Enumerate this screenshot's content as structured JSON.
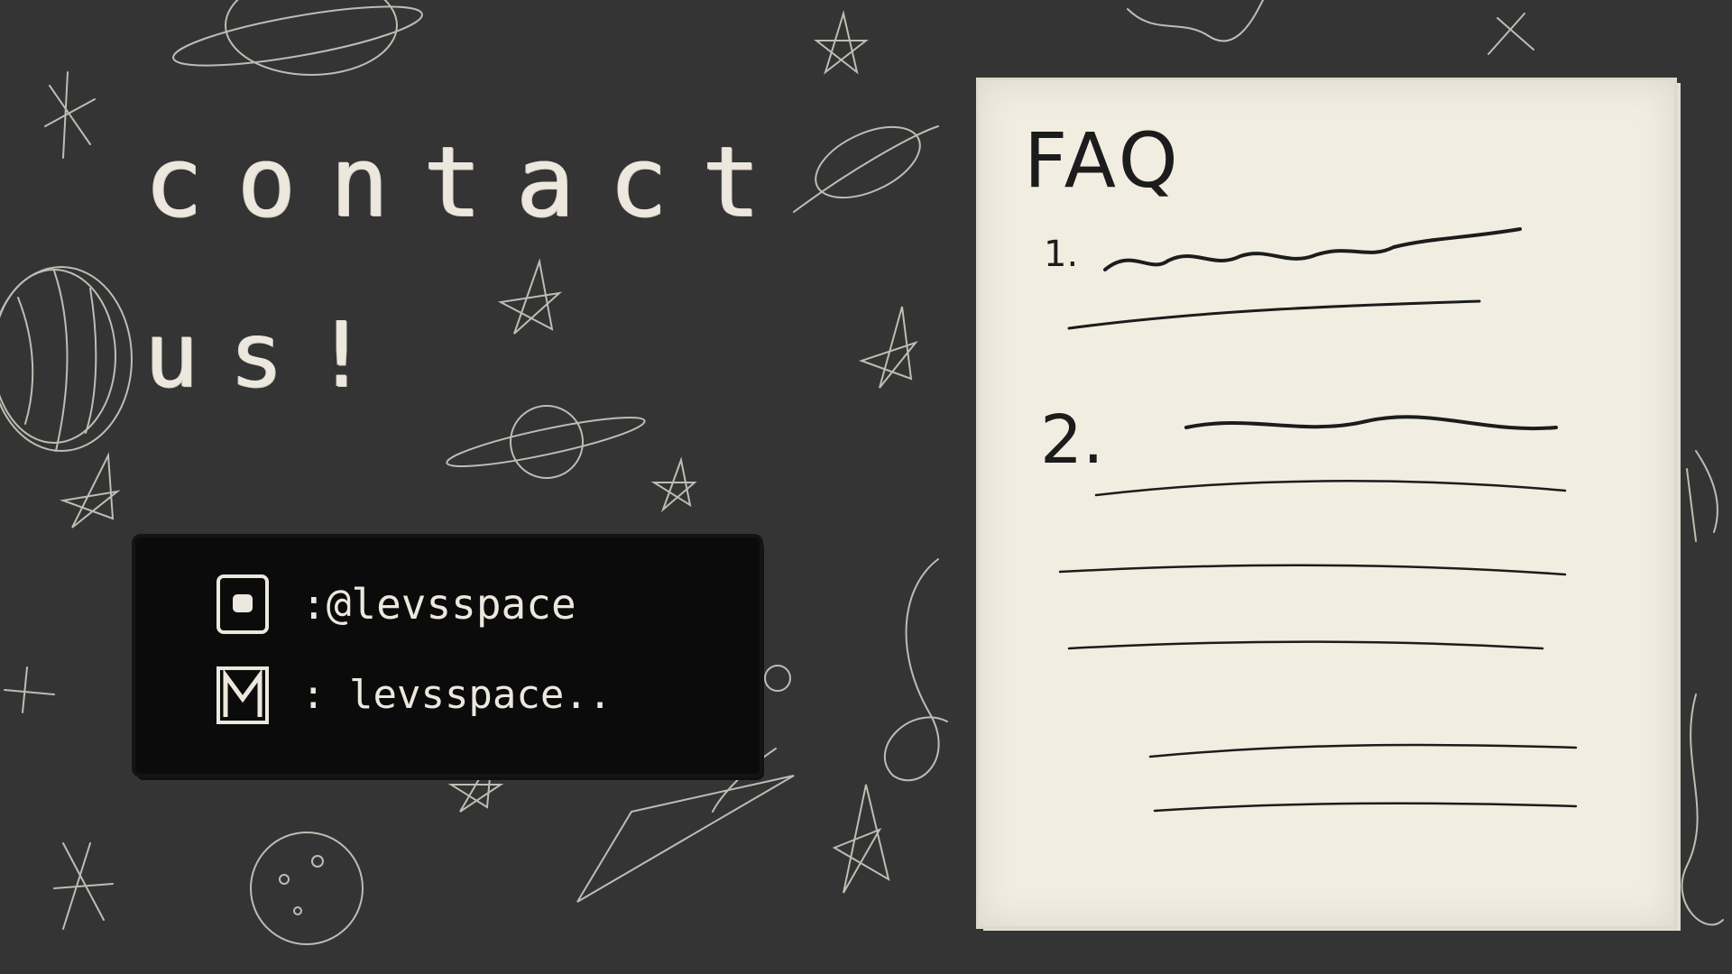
{
  "heading": {
    "line1": "contact",
    "line2": "us!"
  },
  "contact": {
    "instagram_icon": "instagram-icon",
    "instagram_handle": ":@levsspace",
    "email_icon": "gmail-icon",
    "email_handle": ": levsspace.."
  },
  "faq": {
    "title": "FAQ",
    "item1_number": "1.",
    "item2_number": "2."
  },
  "colors": {
    "background": "#343434",
    "chalk": "#ece8de",
    "paper": "#f1ede1",
    "ink": "#1c1c1c",
    "box": "#0b0b0b"
  }
}
